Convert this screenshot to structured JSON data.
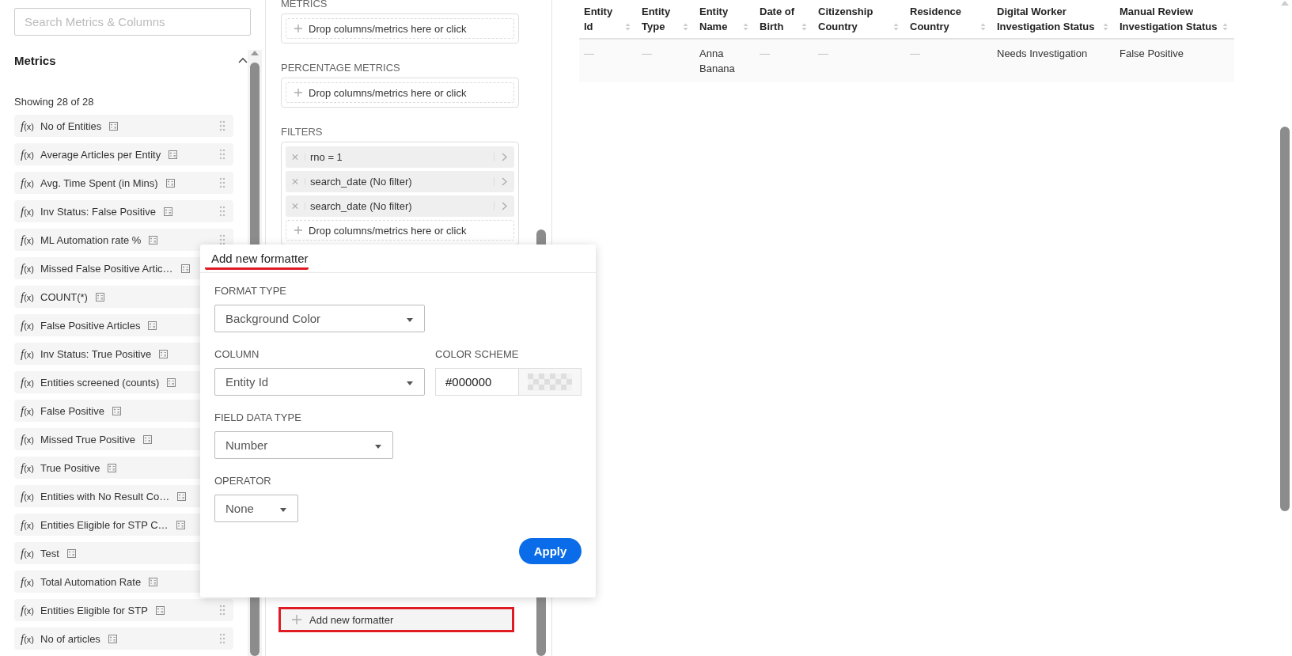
{
  "search": {
    "placeholder": "Search Metrics & Columns"
  },
  "metrics": {
    "title": "Metrics",
    "expanded": true,
    "showing": "Showing 28 of 28",
    "items": [
      {
        "prefix": "*f*(x)",
        "label": "No of Entities"
      },
      {
        "prefix": "*f*(x)",
        "label": "Average Articles per Entity"
      },
      {
        "prefix": "*f*(x)",
        "label": "Avg. Time Spent (in Mins)"
      },
      {
        "prefix": "*f*(x)",
        "label": "Inv Status: False Positive"
      },
      {
        "prefix": "*f*(x)",
        "label": "ML Automation rate %"
      },
      {
        "prefix": "*f*(x)",
        "label": "Missed False Positive Artic…"
      },
      {
        "prefix": "*f*(x)",
        "label": "COUNT(*)"
      },
      {
        "prefix": "*f*(x)",
        "label": "False Positive Articles"
      },
      {
        "prefix": "*f*(x)",
        "label": "Inv Status: True Positive"
      },
      {
        "prefix": "*f*(x)",
        "label": "Entities screened (counts)"
      },
      {
        "prefix": "*f*(x)",
        "label": "False Positive"
      },
      {
        "prefix": "*f*(x)",
        "label": "Missed True Positive"
      },
      {
        "prefix": "*f*(x)",
        "label": "True Positive"
      },
      {
        "prefix": "*f*(x)",
        "label": "Entities with No Result Co…"
      },
      {
        "prefix": "*f*(x)",
        "label": "Entities Eligible for STP C…"
      },
      {
        "prefix": "*f*(x)",
        "label": "Test"
      },
      {
        "prefix": "*f*(x)",
        "label": "Total Automation Rate"
      },
      {
        "prefix": "*f*(x)",
        "label": "Entities Eligible for STP"
      },
      {
        "prefix": "*f*(x)",
        "label": "No of articles"
      }
    ]
  },
  "query": {
    "sections": [
      {
        "title": "METRICS",
        "drop_hint": "Drop columns/metrics here or click"
      },
      {
        "title": "PERCENTAGE METRICS",
        "drop_hint": "Drop columns/metrics here or click"
      },
      {
        "title": "FILTERS",
        "chips": [
          {
            "label": "rno = 1"
          },
          {
            "label": "search_date (No filter)"
          },
          {
            "label": "search_date (No filter)"
          }
        ],
        "drop_hint": "Drop columns/metrics here or click"
      }
    ],
    "formatter_button": {
      "label": "Add new formatter",
      "highlighted": true
    }
  },
  "popup": {
    "title": "Add new formatter",
    "rows": [
      [
        {
          "label": "FORMAT TYPE",
          "kind": "select",
          "value": "Background Color"
        }
      ],
      [
        {
          "label": "COLUMN",
          "kind": "select",
          "value": "Entity Id"
        },
        {
          "label": "COLOR SCHEME",
          "kind": "color",
          "value": "#000000"
        }
      ],
      [
        {
          "label": "FIELD DATA TYPE",
          "kind": "select",
          "value": "Number"
        }
      ],
      [
        {
          "label": "OPERATOR",
          "kind": "select",
          "value": "None"
        }
      ]
    ],
    "apply": "Apply"
  },
  "table": {
    "columns": [
      "Entity Id",
      "Entity Type",
      "Entity Name",
      "Date of Birth",
      "Citizenship Country",
      "Residence Country",
      "Digital Worker Investigation Status",
      "Manual Review Investigation Status"
    ],
    "rows": [
      [
        "—",
        "—",
        "Anna Banana",
        "—",
        "—",
        "—",
        "Needs Investigation",
        "False Positive"
      ]
    ]
  }
}
